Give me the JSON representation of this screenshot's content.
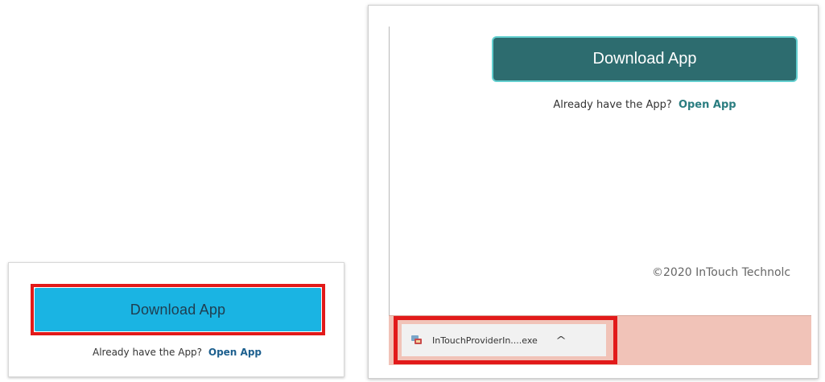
{
  "left_panel": {
    "download_label": "Download App",
    "already_text": "Already have the App?",
    "open_link": "Open App",
    "button_color": "#1ab4e3",
    "highlight_color": "#e21a1a"
  },
  "right_panel": {
    "download_label": "Download App",
    "already_text": "Already have the App?",
    "open_link": "Open App",
    "copyright": "©2020 InTouch Technolc",
    "button_color": "#2d6c6f",
    "download_bar": {
      "file_name": "InTouchProviderIn....exe",
      "file_icon": "installer-icon",
      "chevron": "^",
      "bar_color": "#f1c3b8"
    }
  }
}
